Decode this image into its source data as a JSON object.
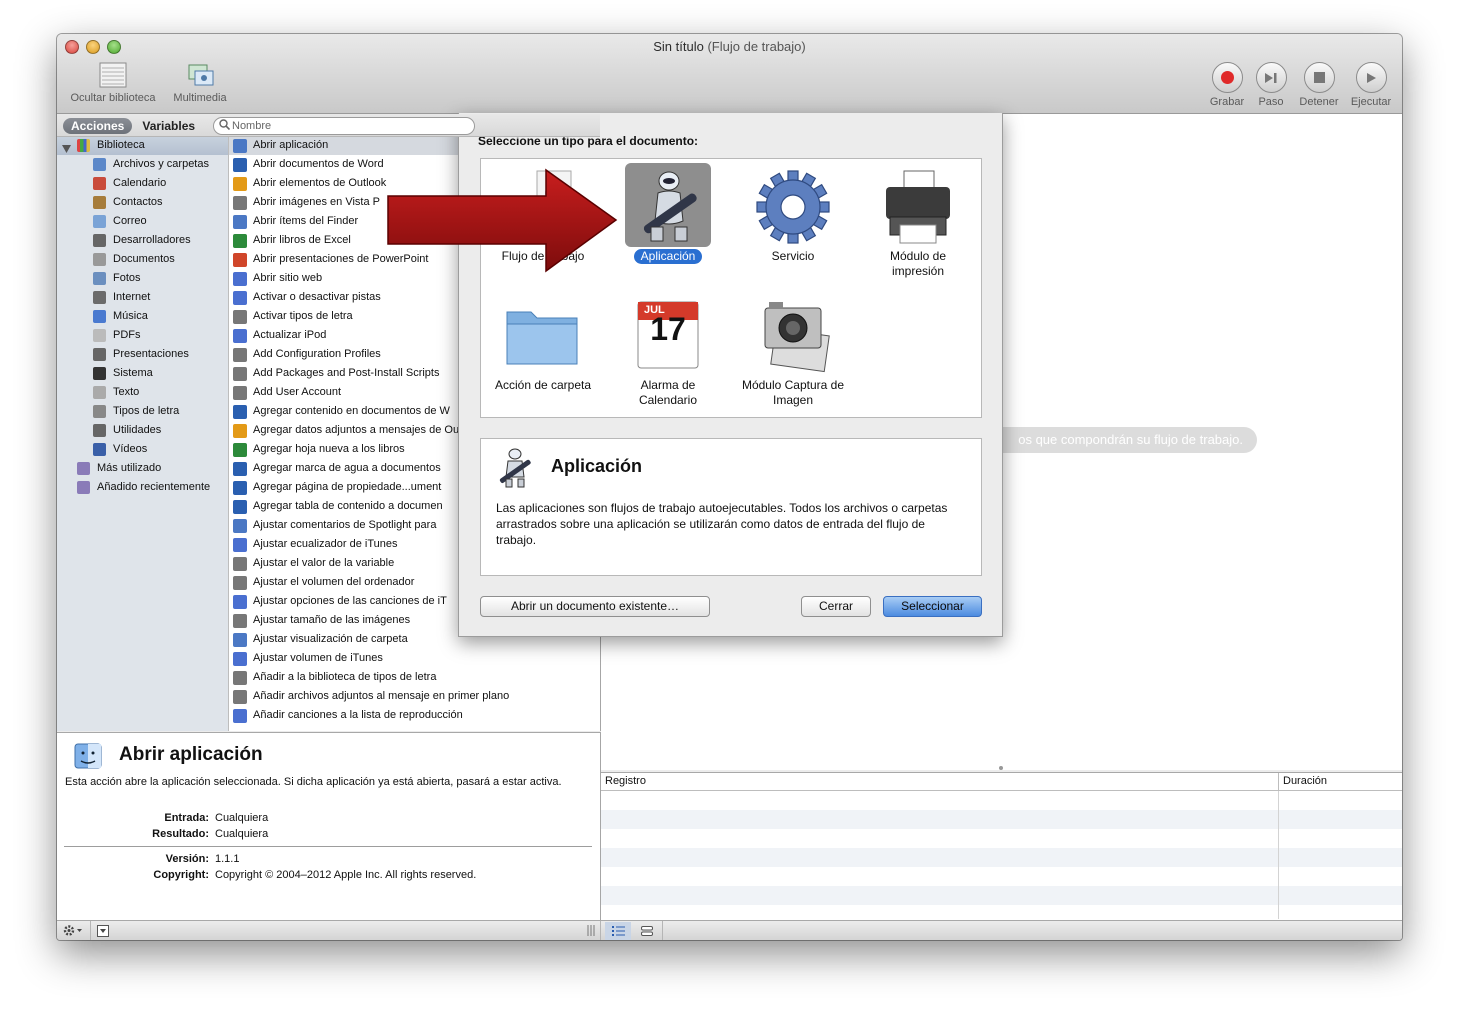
{
  "window": {
    "title": "Sin título",
    "subtitle": "(Flujo de trabajo)"
  },
  "toolbar": {
    "hide_library": "Ocultar biblioteca",
    "media": "Multimedia",
    "record": "Grabar",
    "step": "Paso",
    "stop": "Detener",
    "run": "Ejecutar"
  },
  "tabs": {
    "actions": "Acciones",
    "variables": "Variables"
  },
  "search": {
    "placeholder": "Nombre"
  },
  "library": {
    "root": "Biblioteca",
    "items": [
      "Archivos y carpetas",
      "Calendario",
      "Contactos",
      "Correo",
      "Desarrolladores",
      "Documentos",
      "Fotos",
      "Internet",
      "Música",
      "PDFs",
      "Presentaciones",
      "Sistema",
      "Texto",
      "Tipos de letra",
      "Utilidades",
      "Vídeos"
    ],
    "extra": [
      "Más utilizado",
      "Añadido recientemente"
    ]
  },
  "actions": [
    "Abrir aplicación",
    "Abrir documentos de Word",
    "Abrir elementos de Outlook",
    "Abrir imágenes en Vista P",
    "Abrir ítems del Finder",
    "Abrir libros de Excel",
    "Abrir presentaciones de PowerPoint",
    "Abrir sitio web",
    "Activar o desactivar pistas",
    "Activar tipos de letra",
    "Actualizar iPod",
    "Add Configuration Profiles",
    "Add Packages and Post-Install Scripts",
    "Add User Account",
    "Agregar contenido en documentos de W",
    "Agregar datos adjuntos a mensajes de Outlook",
    "Agregar hoja nueva a los libros",
    "Agregar marca de agua a documentos",
    "Agregar página de propiedade...ument",
    "Agregar tabla de contenido a documen",
    "Ajustar comentarios de Spotlight para",
    "Ajustar ecualizador de iTunes",
    "Ajustar el valor de la variable",
    "Ajustar el volumen del ordenador",
    "Ajustar opciones de las canciones de iT",
    "Ajustar tamaño de las imágenes",
    "Ajustar visualización de carpeta",
    "Ajustar volumen de iTunes",
    "Añadir a la biblioteca de tipos de letra",
    "Añadir archivos adjuntos al mensaje en primer plano",
    "Añadir canciones a la lista de reproducción"
  ],
  "description": {
    "title": "Abrir aplicación",
    "text": "Esta acción abre la aplicación seleccionada. Si dicha aplicación ya está abierta, pasará a estar activa.",
    "input_label": "Entrada:",
    "input_value": "Cualquiera",
    "result_label": "Resultado:",
    "result_value": "Cualquiera",
    "version_label": "Versión:",
    "version_value": "1.1.1",
    "copyright_label": "Copyright:",
    "copyright_value": "Copyright © 2004–2012 Apple Inc.  All rights reserved."
  },
  "workflow": {
    "hint": "os que compondrán su flujo de trabajo."
  },
  "log": {
    "col_log": "Registro",
    "col_duration": "Duración"
  },
  "sheet": {
    "header": "Seleccione un tipo para el documento:",
    "types": [
      {
        "label": "Flujo de trabajo",
        "icon": "workflow-icon"
      },
      {
        "label": "Aplicación",
        "icon": "automator-robot-icon",
        "selected": true
      },
      {
        "label": "Servicio",
        "icon": "gear-icon"
      },
      {
        "label": "Módulo de impresión",
        "icon": "printer-icon"
      },
      {
        "label": "Acción de carpeta",
        "icon": "folder-icon"
      },
      {
        "label": "Alarma de Calendario",
        "icon": "calendar-icon"
      },
      {
        "label": "Módulo Captura de Imagen",
        "icon": "camera-icon"
      }
    ],
    "calendar_month": "JUL",
    "calendar_day": "17",
    "info_title": "Aplicación",
    "info_text": "Las aplicaciones son flujos de trabajo autoejecutables. Todos los archivos o carpetas arrastrados sobre una aplicación se utilizarán como datos de entrada del flujo de trabajo.",
    "open_existing": "Abrir un documento existente…",
    "close": "Cerrar",
    "select": "Seleccionar"
  },
  "colors": {
    "selection_blue": "#2a6fd1",
    "arrow_red": "#a31515",
    "close_light": "#e0443e",
    "minimize_light": "#dea123",
    "zoom_light": "#5bb136"
  }
}
